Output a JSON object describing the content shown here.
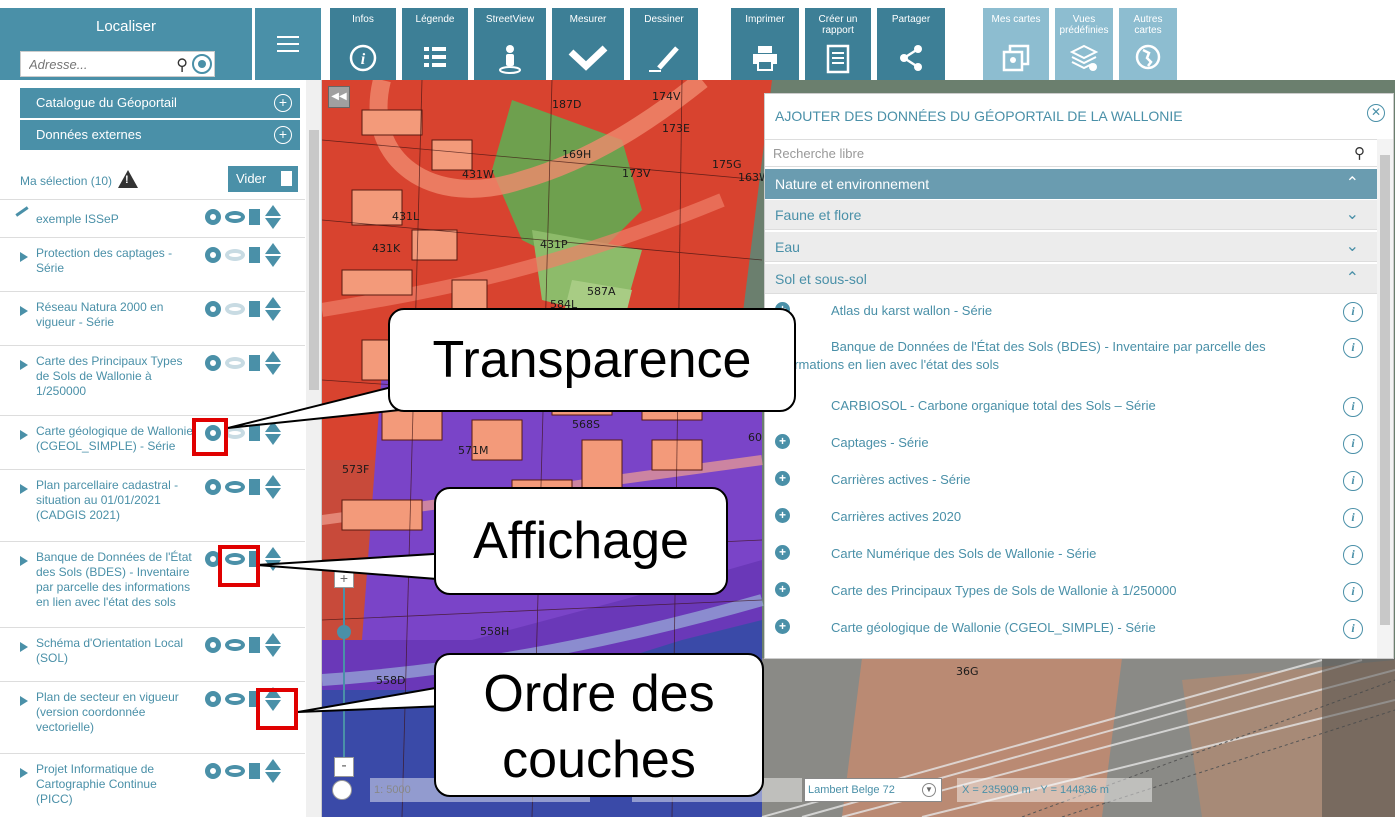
{
  "toolbar": {
    "localiser_title": "Localiser",
    "address_placeholder": "Adresse...",
    "buttons": [
      {
        "label": "Infos"
      },
      {
        "label": "Légende"
      },
      {
        "label": "StreetView"
      },
      {
        "label": "Mesurer"
      },
      {
        "label": "Dessiner"
      },
      {
        "label": "Imprimer"
      },
      {
        "label": "Créer un rapport"
      },
      {
        "label": "Partager"
      },
      {
        "label": "Mes cartes"
      },
      {
        "label": "Vues prédéfinies"
      },
      {
        "label": "Autres cartes"
      }
    ]
  },
  "sidebar": {
    "catalog_label": "Catalogue du Géoportail",
    "external_label": "Données externes",
    "selection_label": "Ma sélection (10)",
    "clear_label": "Vider",
    "layers": [
      {
        "name": "exemple ISSeP",
        "visible": true
      },
      {
        "name": "Protection des captages - Série",
        "visible": false
      },
      {
        "name": "Réseau Natura 2000 en vigueur - Série",
        "visible": false
      },
      {
        "name": "Carte des Principaux Types de Sols de Wallonie à 1/250000",
        "visible": false
      },
      {
        "name": "Carte géologique de Wallonie (CGEOL_SIMPLE) - Série",
        "visible": false
      },
      {
        "name": "Plan parcellaire cadastral - situation au 01/01/2021 (CADGIS 2021)",
        "visible": true
      },
      {
        "name": "Banque de Données de l'État des Sols (BDES) - Inventaire par parcelle des informations en lien avec l'état des sols",
        "visible": true
      },
      {
        "name": "Schéma d'Orientation Local (SOL)",
        "visible": true
      },
      {
        "name": "Plan de secteur en vigueur (version coordonnée vectorielle)",
        "visible": true
      },
      {
        "name": "Projet Informatique de Cartographie Continue (PICC)",
        "visible": true
      }
    ]
  },
  "map": {
    "labels": [
      "187D",
      "174V",
      "173E",
      "169H",
      "431W",
      "173V",
      "175G",
      "163W",
      "431L",
      "431K",
      "431P",
      "587A",
      "584L",
      "568S",
      "571M",
      "573F",
      "60",
      "558H",
      "558D",
      "36G"
    ],
    "scale": "1: 5000",
    "coord_label": "ées du pointeur en",
    "projection": "Lambert Belge 72",
    "coords": "X = 235909 m  - Y = 144836 m"
  },
  "panel": {
    "title": "AJOUTER DES DONNÉES DU GÉOPORTAIL DE LA WALLONIE",
    "search_placeholder": "Recherche libre",
    "main_category": "Nature et environnement",
    "subcategories": [
      "Faune et flore",
      "Eau",
      "Sol et sous-sol"
    ],
    "items": [
      "Atlas du karst wallon - Série",
      "Banque de Données de l'État des Sols (BDES) - Inventaire par parcelle des ormations en lien avec l'état des sols",
      "CARBIOSOL - Carbone organique total des Sols – Série",
      "Captages - Série",
      "Carrières actives - Série",
      "Carrières actives 2020",
      "Carte Numérique des Sols de Wallonie - Série",
      "Carte des Principaux Types de Sols de Wallonie à 1/250000",
      "Carte géologique de Wallonie (CGEOL_SIMPLE) - Série"
    ]
  },
  "callouts": {
    "transparence": "Transparence",
    "affichage": "Affichage",
    "ordre_line1": "Ordre des",
    "ordre_line2": "couches"
  },
  "colors": {
    "accent": "#4a90a8",
    "callout_red": "#e00000"
  }
}
